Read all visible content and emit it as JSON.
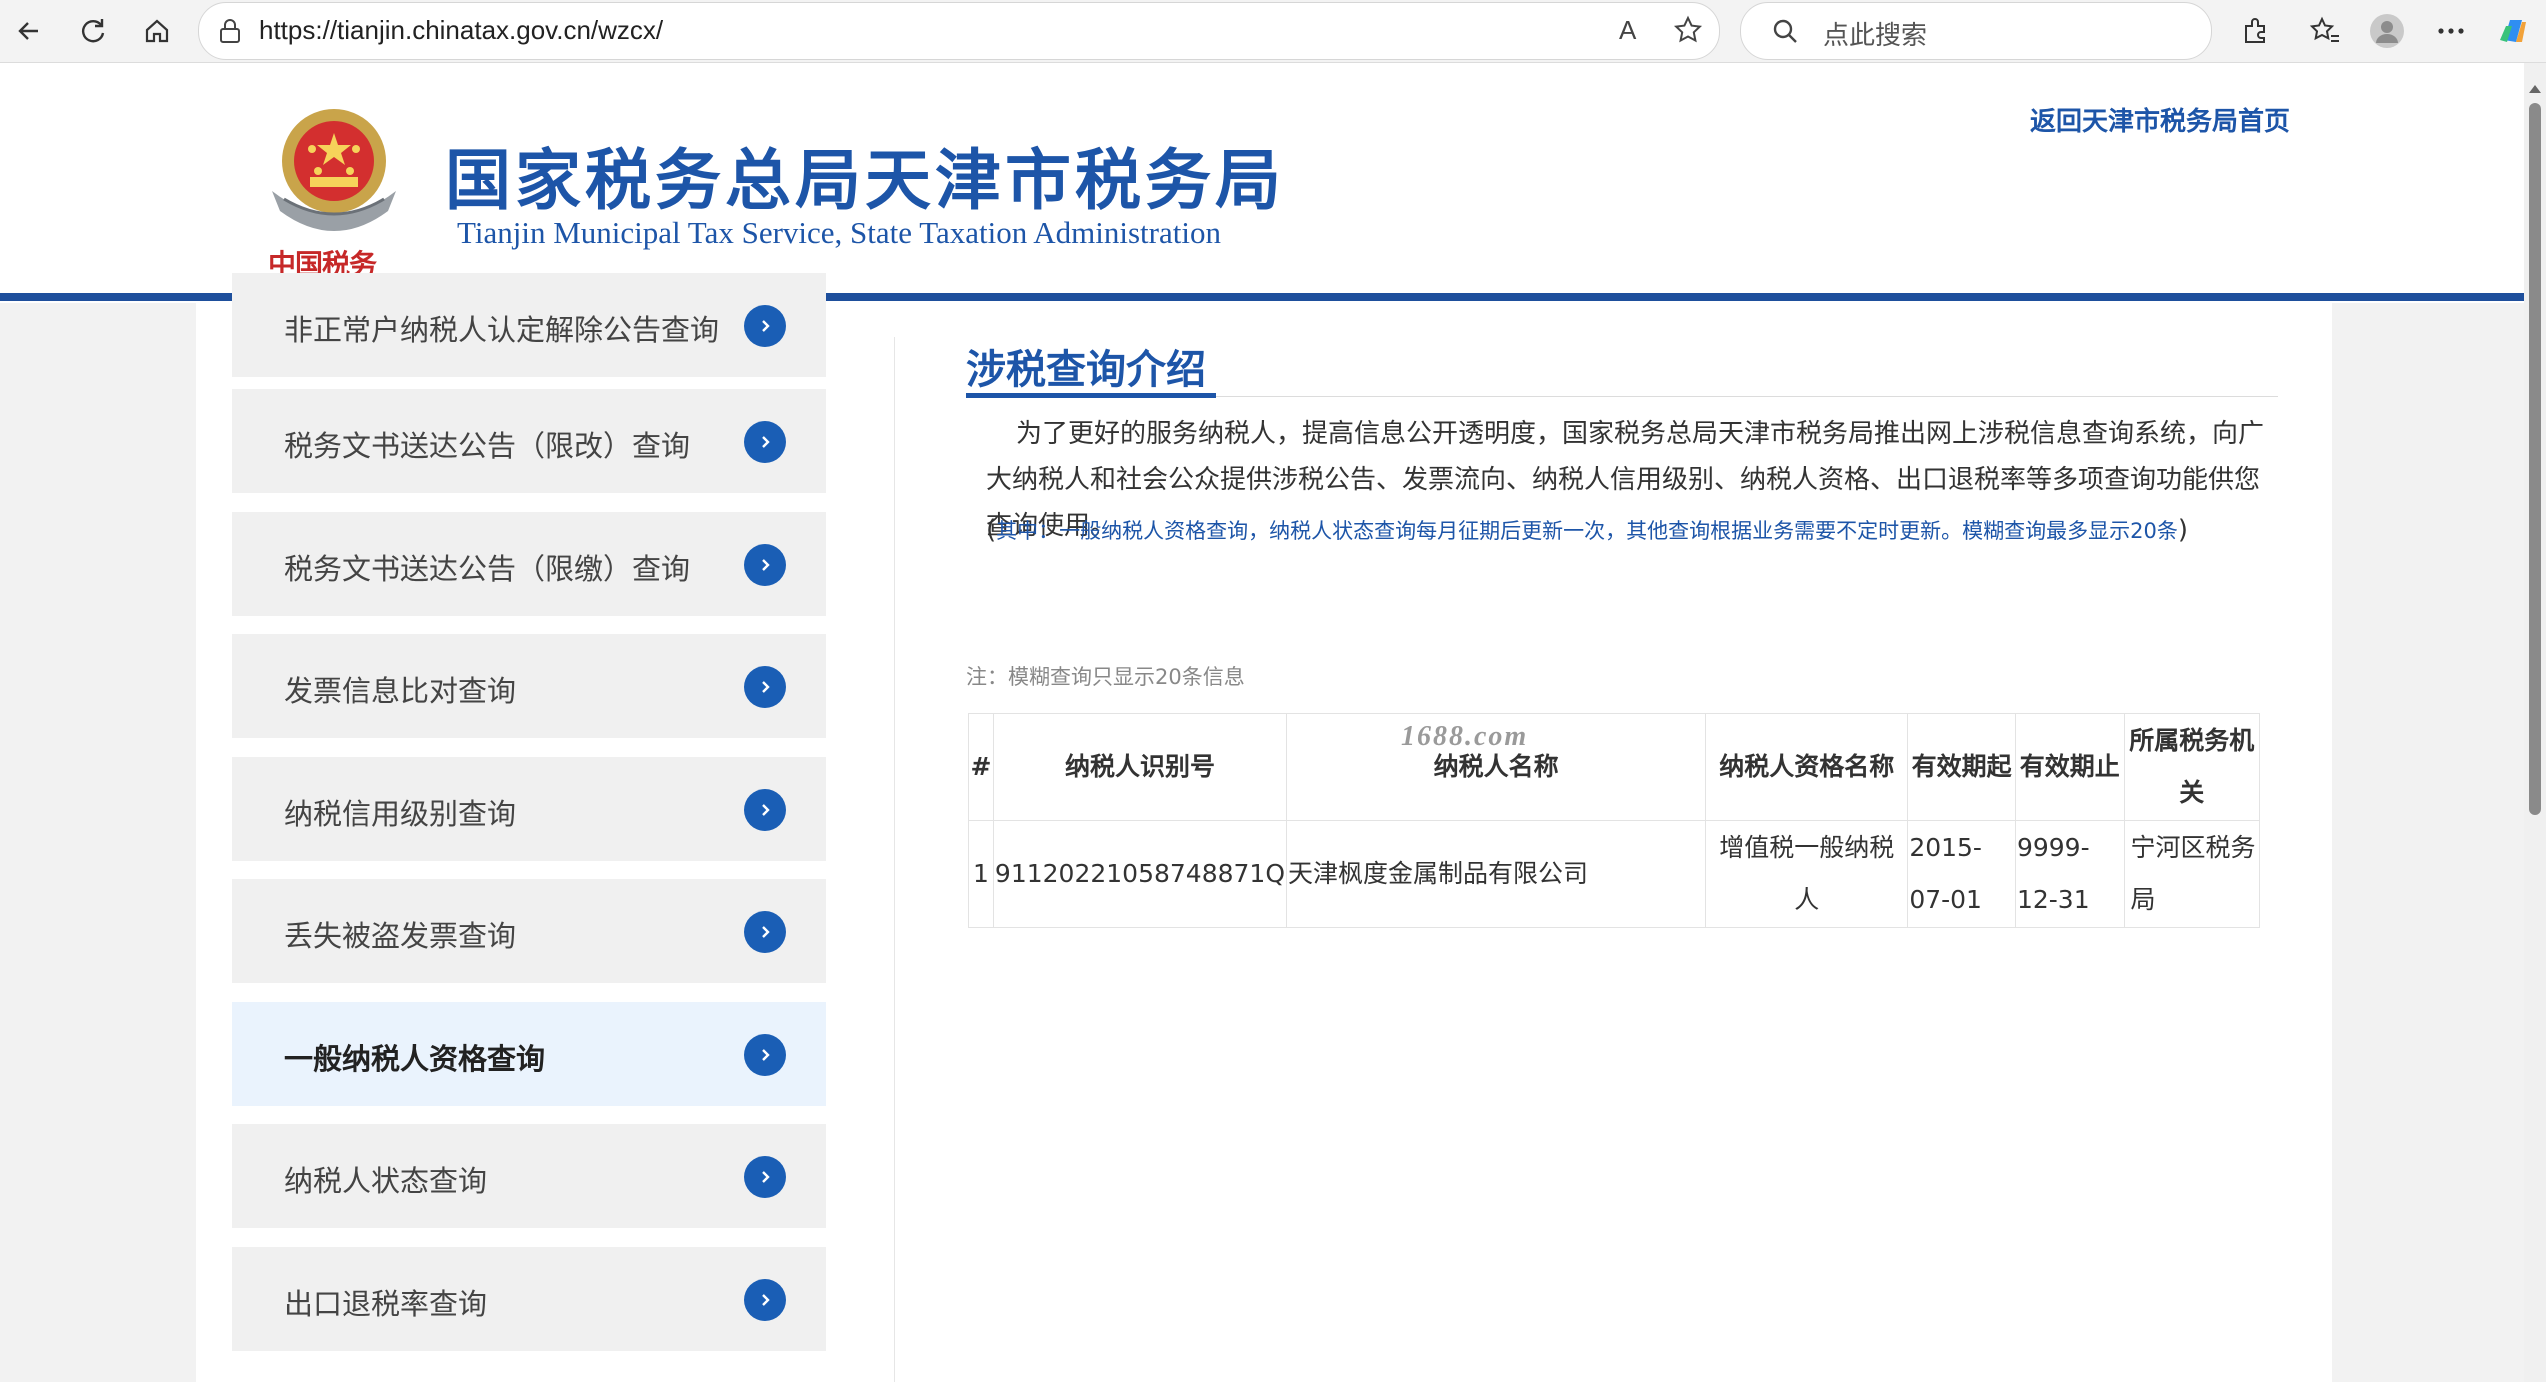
{
  "browser": {
    "url": "https://tianjin.chinatax.gov.cn/wzcx/",
    "search_placeholder": "点此搜索",
    "read_aloud": "A"
  },
  "header": {
    "title": "国家税务总局天津市税务局",
    "subtitle": "Tianjin Municipal Tax Service, State Taxation Administration",
    "logo_text": "中国税务",
    "home_link": "返回天津市税务局首页"
  },
  "sidebar": {
    "items": [
      {
        "label": "非正常户纳税人认定解除公告查询",
        "active": false
      },
      {
        "label": "税务文书送达公告（限改）查询",
        "active": false
      },
      {
        "label": "税务文书送达公告（限缴）查询",
        "active": false
      },
      {
        "label": "发票信息比对查询",
        "active": false
      },
      {
        "label": "纳税信用级别查询",
        "active": false
      },
      {
        "label": "丢失被盗发票查询",
        "active": false
      },
      {
        "label": "一般纳税人资格查询",
        "active": true
      },
      {
        "label": "纳税人状态查询",
        "active": false
      },
      {
        "label": "出口退税率查询",
        "active": false
      }
    ]
  },
  "main": {
    "intro_title": "涉税查询介绍",
    "intro_text": "为了更好的服务纳税人，提高信息公开透明度，国家税务总局天津市税务局推出网上涉税信息查询系统，向广大纳税人和社会公众提供涉税公告、发票流向、纳税人信用级别、纳税人资格、出口退税率等多项查询功能供您查询使用。",
    "intro_note_open": "(",
    "intro_note": "其中：一般纳税人资格查询，纳税人状态查询每月征期后更新一次，其他查询根据业务需要不定时更新。模糊查询最多显示20条",
    "intro_note_close": ")",
    "table_note": "注：模糊查询只显示20条信息",
    "watermark": "1688.com",
    "table": {
      "headers": [
        "#",
        "纳税人识别号",
        "纳税人名称",
        "纳税人资格名称",
        "有效期起",
        "有效期止",
        "所属税务机关"
      ],
      "rows": [
        [
          "1",
          "91120221058748871Q",
          "天津枫度金属制品有限公司",
          "增值税一般纳税人",
          "2015-07-01",
          "9999-12-31",
          "宁河区税务局"
        ]
      ]
    }
  },
  "colors": {
    "brand_blue": "#1d55a8",
    "menu_button": "#1a5eb5",
    "active_menu_bg": "#eaf3fd"
  }
}
